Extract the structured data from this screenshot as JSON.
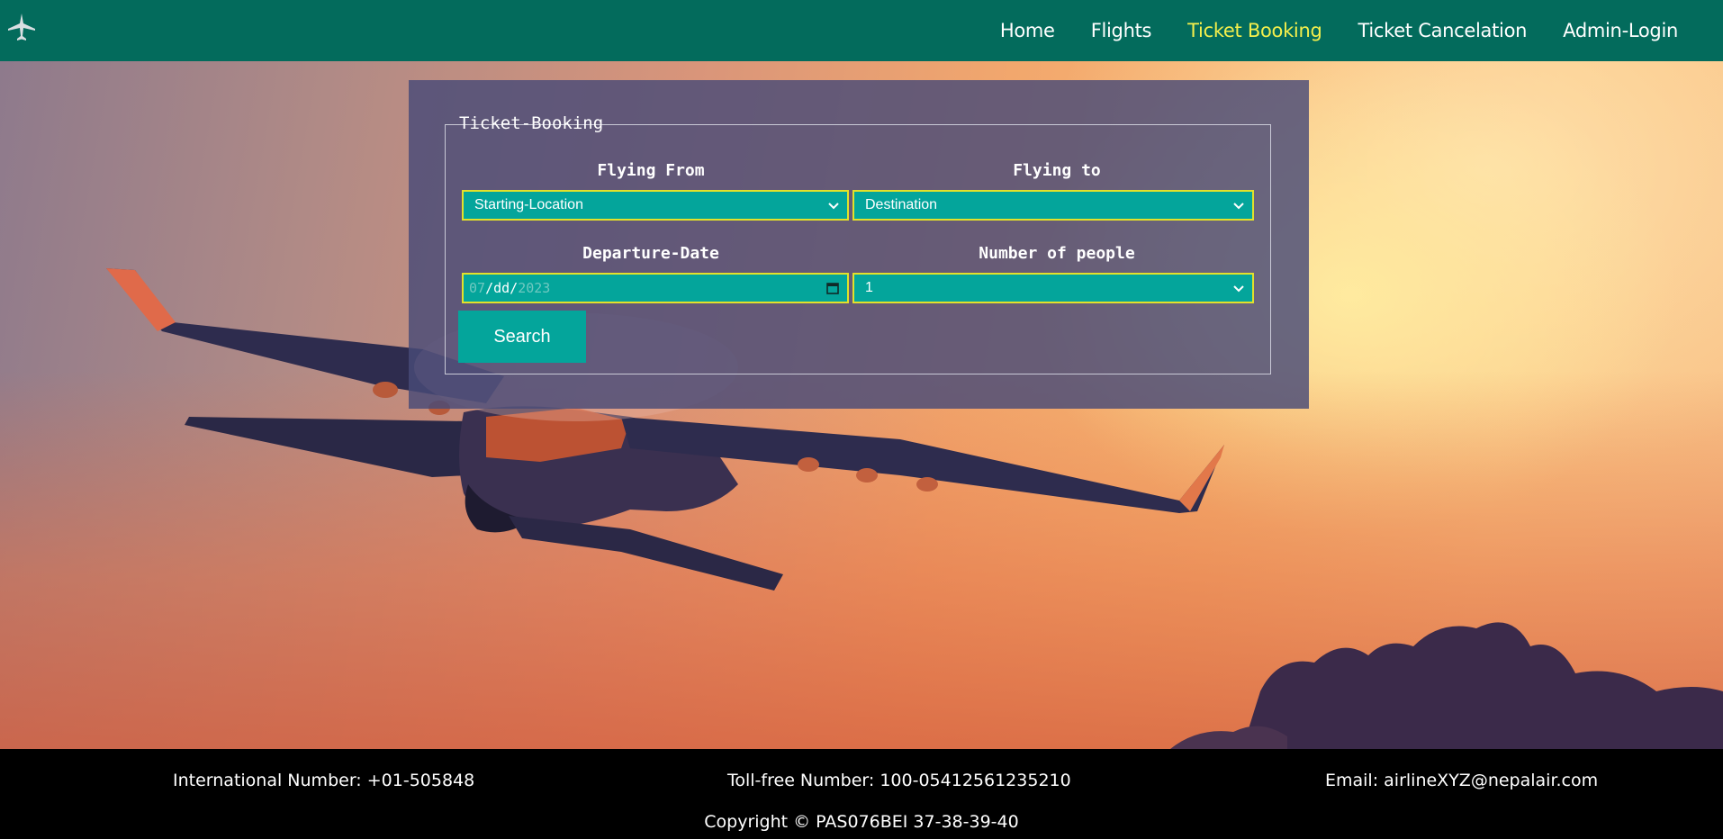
{
  "nav": {
    "logo_icon": "airplane-icon",
    "links": [
      {
        "label": "Home"
      },
      {
        "label": "Flights"
      },
      {
        "label": "Ticket Booking",
        "active": true
      },
      {
        "label": "Ticket Cancelation"
      },
      {
        "label": "Admin-Login"
      }
    ],
    "active_color": "#f4ef4c",
    "bg_color": "#036b5c"
  },
  "booking": {
    "legend": "Ticket-Booking",
    "flying_from": {
      "label": "Flying From",
      "value": "Starting-Location"
    },
    "flying_to": {
      "label": "Flying to",
      "value": "Destination"
    },
    "departure": {
      "label": "Departure-Date",
      "mm": "07",
      "dd": "dd",
      "yyyy": "2023",
      "sep": "/"
    },
    "people": {
      "label": "Number of people",
      "value": "1"
    },
    "search_label": "Search",
    "field_color": "#04a59b",
    "field_border": "#e3e12a"
  },
  "footer": {
    "international": "International Number: +01-505848",
    "tollfree": "Toll-free Number: 100-05412561235210",
    "email": "Email: airlineXYZ@nepalair.com",
    "copyright": "Copyright © PAS076BEI 37-38-39-40"
  }
}
